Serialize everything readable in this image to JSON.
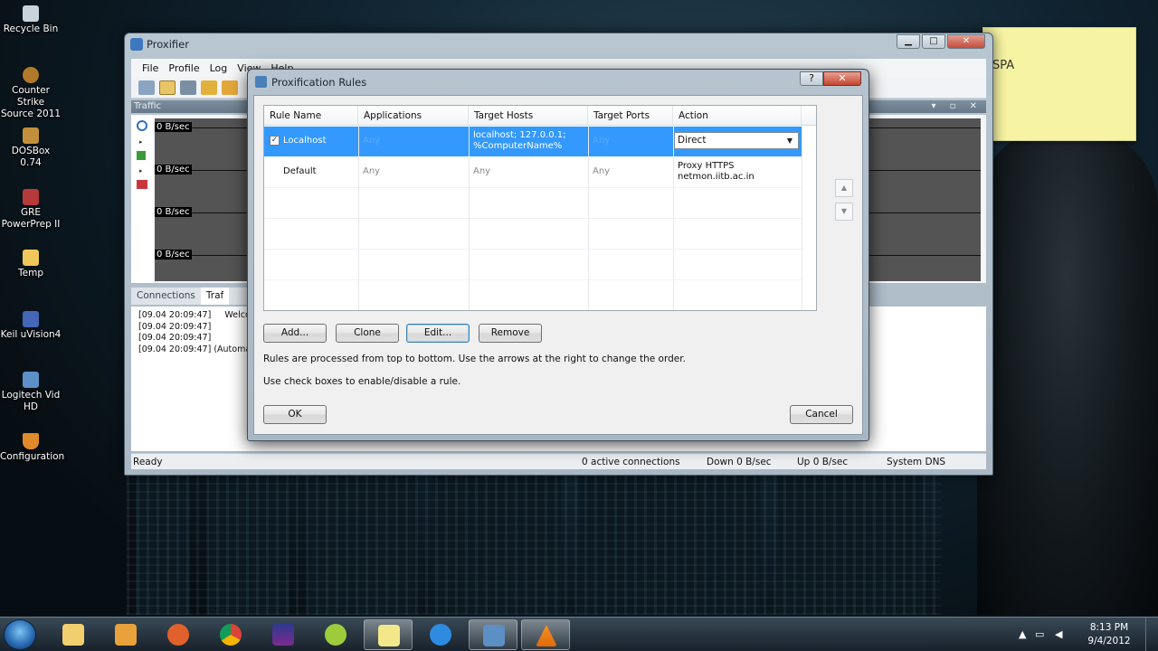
{
  "desktop": {
    "icons": [
      {
        "label": "Recycle Bin",
        "icon": "recycle-bin-icon"
      },
      {
        "label": "Counter Strike Source 2011",
        "icon": "counter-strike-icon"
      },
      {
        "label": "DOSBox 0.74",
        "icon": "dosbox-icon"
      },
      {
        "label": "GRE PowerPrep II",
        "icon": "gre-icon"
      },
      {
        "label": "Temp",
        "icon": "folder-icon"
      },
      {
        "label": "Keil uVision4",
        "icon": "keil-icon"
      },
      {
        "label": "Logitech Vid HD",
        "icon": "logitech-icon"
      },
      {
        "label": "Configuration",
        "icon": "configuration-icon"
      }
    ],
    "sticky_note": "SPA"
  },
  "main_window": {
    "title": "Proxifier",
    "menu": [
      "File",
      "Profile",
      "Log",
      "View",
      "Help"
    ],
    "traffic_pane_title": "Traffic",
    "rates": [
      "0 B/sec",
      "0 B/sec",
      "0 B/sec",
      "0 B/sec"
    ],
    "tabs": [
      "Connections",
      "Traf"
    ],
    "log_lines": [
      {
        "time": "[09.04 20:09:47]",
        "text": "Welco"
      },
      {
        "time": "[09.04 20:09:47]",
        "text": ""
      },
      {
        "time": "[09.04 20:09:47]",
        "text": ""
      },
      {
        "time": "[09.04 20:09:47]",
        "text": "(Automati"
      }
    ],
    "status": {
      "ready": "Ready",
      "connections": "0 active connections",
      "down": "Down 0 B/sec",
      "up": "Up 0 B/sec",
      "dns": "System DNS"
    }
  },
  "dialog": {
    "title": "Proxification Rules",
    "help_label": "?",
    "columns": [
      "Rule Name",
      "Applications",
      "Target Hosts",
      "Target Ports",
      "Action"
    ],
    "rules": [
      {
        "enabled": true,
        "name": "Localhost",
        "applications": "Any",
        "target_hosts": "localhost; 127.0.0.1; %ComputerName%",
        "target_ports": "Any",
        "action": "Direct",
        "selected": true
      },
      {
        "enabled": false,
        "name": "Default",
        "applications": "Any",
        "target_hosts": "Any",
        "target_ports": "Any",
        "action": "Proxy HTTPS netmon.iitb.ac.in",
        "selected": false
      }
    ],
    "buttons": {
      "add": "Add...",
      "clone": "Clone",
      "edit": "Edit...",
      "remove": "Remove",
      "ok": "OK",
      "cancel": "Cancel"
    },
    "notes": [
      "Rules are processed from top to bottom. Use the arrows at the right to change the order.",
      "Use check boxes to enable/disable a rule."
    ]
  },
  "taskbar": {
    "time": "8:13 PM",
    "date": "9/4/2012",
    "apps": [
      "explorer",
      "media-player",
      "firefox",
      "chrome",
      "winamp",
      "messenger",
      "sticky-notes",
      "internet-explorer",
      "proxifier",
      "vlc"
    ]
  }
}
